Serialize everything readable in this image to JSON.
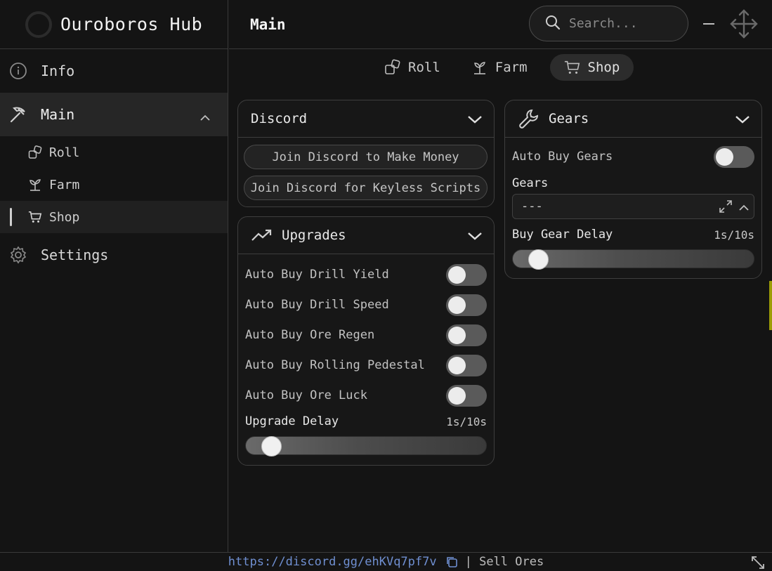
{
  "app": {
    "name": "Ouroboros Hub"
  },
  "sidebar": {
    "items": [
      {
        "label": "Info",
        "icon": "info-icon"
      },
      {
        "label": "Main",
        "icon": "pickaxe-icon",
        "expanded": true,
        "children": [
          {
            "label": "Roll",
            "icon": "dice-icon"
          },
          {
            "label": "Farm",
            "icon": "sprout-icon"
          },
          {
            "label": "Shop",
            "icon": "cart-icon",
            "active": true
          }
        ]
      },
      {
        "label": "Settings",
        "icon": "gear-icon"
      }
    ]
  },
  "header": {
    "title": "Main",
    "search_placeholder": "Search..."
  },
  "tabs": [
    {
      "label": "Roll",
      "icon": "dice-icon"
    },
    {
      "label": "Farm",
      "icon": "sprout-icon"
    },
    {
      "label": "Shop",
      "icon": "cart-icon",
      "active": true
    }
  ],
  "discord_card": {
    "title": "Discord",
    "buttons": [
      "Join Discord to Make Money",
      "Join Discord for Keyless Scripts"
    ]
  },
  "upgrades_card": {
    "title": "Upgrades",
    "toggles": [
      {
        "label": "Auto Buy Drill Yield",
        "on": false
      },
      {
        "label": "Auto Buy Drill Speed",
        "on": false
      },
      {
        "label": "Auto Buy Ore Regen",
        "on": false
      },
      {
        "label": "Auto Buy Rolling Pedestal",
        "on": false
      },
      {
        "label": "Auto Buy Ore Luck",
        "on": false
      }
    ],
    "slider": {
      "label": "Upgrade Delay",
      "value_text": "1s/10s",
      "fraction": 0.0
    }
  },
  "gears_card": {
    "title": "Gears",
    "toggle": {
      "label": "Auto Buy Gears",
      "on": false
    },
    "dropdown": {
      "label": "Gears",
      "value": "---"
    },
    "slider": {
      "label": "Buy Gear Delay",
      "value_text": "1s/10s",
      "fraction": 0.0
    }
  },
  "footer": {
    "link": "https://discord.gg/ehKVq7pf7v",
    "status": "| Sell Ores"
  },
  "colors": {
    "background": "#141414",
    "panel": "#171717",
    "link": "#6f8fd1",
    "toggle_off": "#5a5a5a"
  }
}
